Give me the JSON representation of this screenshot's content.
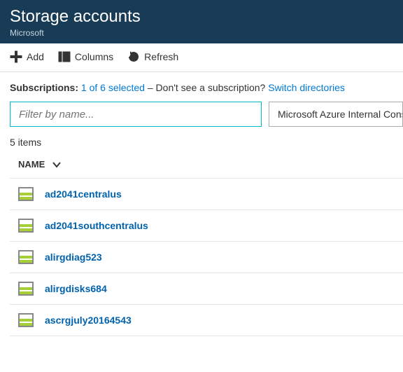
{
  "header": {
    "title": "Storage accounts",
    "subtitle": "Microsoft"
  },
  "toolbar": {
    "add": "Add",
    "columns": "Columns",
    "refresh": "Refresh"
  },
  "subscriptions": {
    "label": "Subscriptions:",
    "selected": "1 of 6 selected",
    "dash": " – ",
    "hint": "Don't see a subscription? ",
    "switch": "Switch directories"
  },
  "filter": {
    "placeholder": "Filter by name...",
    "dropdown": "Microsoft Azure Internal Consumption"
  },
  "count_label": "5 items",
  "columns": {
    "name": "NAME"
  },
  "items": [
    {
      "name": "ad2041centralus"
    },
    {
      "name": "ad2041southcentralus"
    },
    {
      "name": "alirgdiag523"
    },
    {
      "name": "alirgdisks684"
    },
    {
      "name": "ascrgjuly20164543"
    }
  ]
}
